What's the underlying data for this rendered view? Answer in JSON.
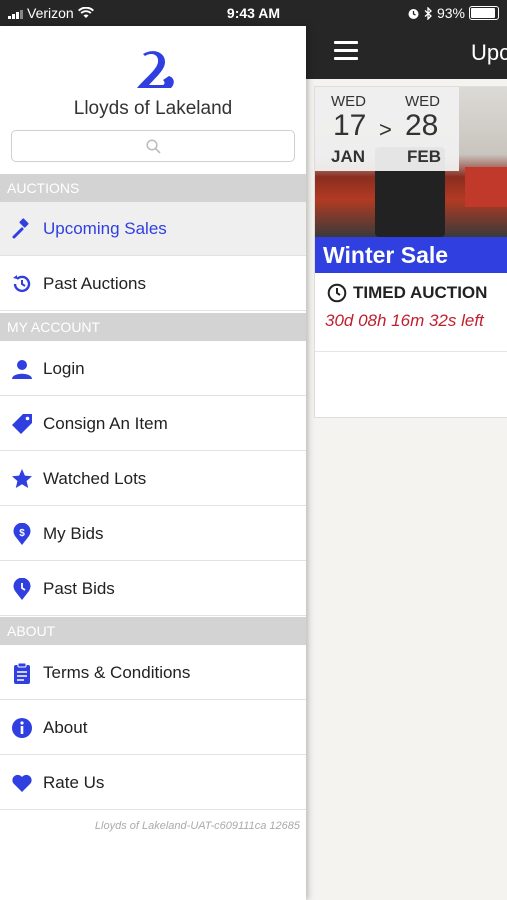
{
  "status_bar": {
    "carrier": "Verizon",
    "time": "9:43 AM",
    "battery": "93%"
  },
  "app": {
    "brand": "Lloyds of Lakeland",
    "accent_color": "#2f3fe0"
  },
  "search": {
    "placeholder": ""
  },
  "drawer": {
    "sections": [
      {
        "title": "AUCTIONS",
        "items": [
          {
            "label": "Upcoming Sales",
            "icon": "gavel-icon",
            "active": true
          },
          {
            "label": "Past Auctions",
            "icon": "history-icon",
            "active": false
          }
        ]
      },
      {
        "title": "MY ACCOUNT",
        "items": [
          {
            "label": "Login",
            "icon": "user-icon"
          },
          {
            "label": "Consign An Item",
            "icon": "tag-icon"
          },
          {
            "label": "Watched Lots",
            "icon": "star-icon"
          },
          {
            "label": "My Bids",
            "icon": "dollar-pin-icon"
          },
          {
            "label": "Past Bids",
            "icon": "clock-pin-icon"
          }
        ]
      },
      {
        "title": "ABOUT",
        "items": [
          {
            "label": "Terms & Conditions",
            "icon": "clipboard-icon"
          },
          {
            "label": "About",
            "icon": "info-icon"
          },
          {
            "label": "Rate Us",
            "icon": "heart-icon"
          }
        ]
      }
    ],
    "footer": "Lloyds of Lakeland-UAT-c609111ca 12685"
  },
  "main": {
    "title": "Upc",
    "sale_card": {
      "start_day": "WED",
      "start_date": "17",
      "start_month": "JAN",
      "arrow": ">",
      "end_day": "WED",
      "end_date": "28",
      "end_month": "FEB",
      "name": "Winter Sale",
      "type": "TIMED AUCTION",
      "countdown": "30d 08h 16m 32s left"
    }
  }
}
